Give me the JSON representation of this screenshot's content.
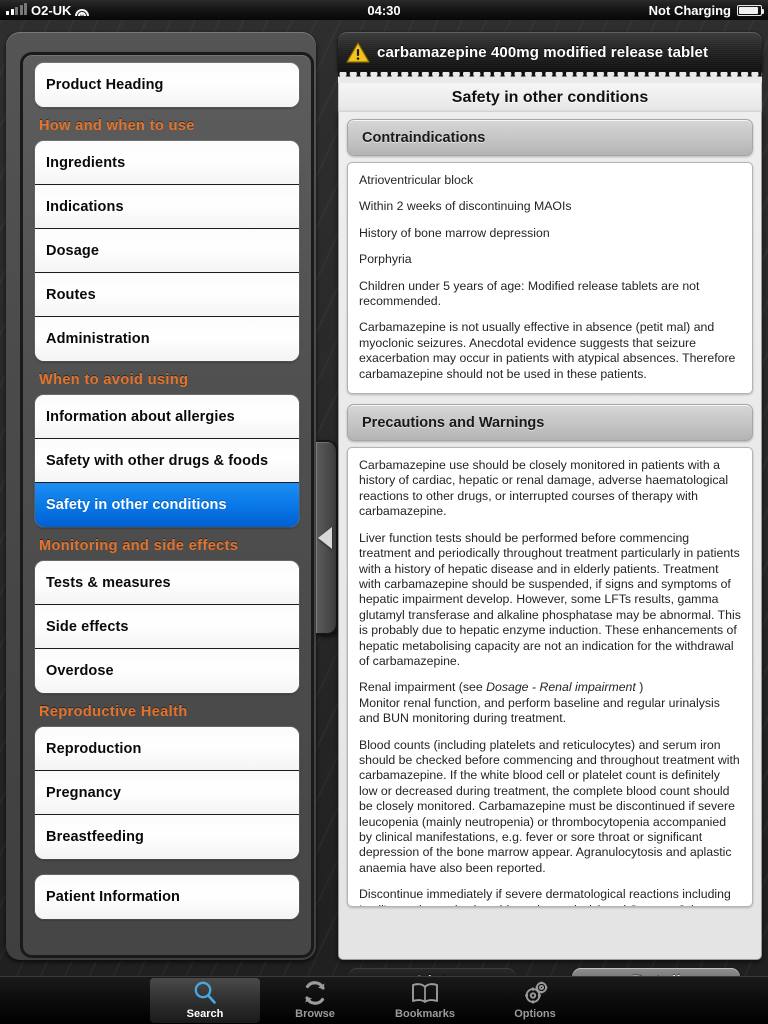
{
  "status_bar": {
    "carrier": "O2-UK",
    "signal_icon": "signal-bars-icon",
    "wifi_icon": "wifi-icon",
    "time": "04:30",
    "battery_text": "Not Charging",
    "battery_icon": "battery-icon"
  },
  "sidebar": {
    "collapse_handle_icon": "chevron-left-icon",
    "groups": [
      {
        "header": null,
        "items": [
          {
            "label": "Product Heading",
            "selected": false
          }
        ]
      },
      {
        "header": "How and  when to use",
        "items": [
          {
            "label": "Ingredients",
            "selected": false
          },
          {
            "label": "Indications",
            "selected": false
          },
          {
            "label": "Dosage",
            "selected": false
          },
          {
            "label": "Routes",
            "selected": false
          },
          {
            "label": "Administration",
            "selected": false
          }
        ]
      },
      {
        "header": "When to avoid using",
        "items": [
          {
            "label": "Information about allergies",
            "selected": false
          },
          {
            "label": "Safety with other drugs & foods",
            "selected": false
          },
          {
            "label": "Safety in other conditions",
            "selected": true
          }
        ]
      },
      {
        "header": "Monitoring and side effects",
        "items": [
          {
            "label": "Tests & measures",
            "selected": false
          },
          {
            "label": "Side effects",
            "selected": false
          },
          {
            "label": "Overdose",
            "selected": false
          }
        ]
      },
      {
        "header": "Reproductive Health",
        "items": [
          {
            "label": "Reproduction",
            "selected": false
          },
          {
            "label": "Pregnancy",
            "selected": false
          },
          {
            "label": "Breastfeeding",
            "selected": false
          }
        ]
      },
      {
        "header": null,
        "items": [
          {
            "label": "Patient Information",
            "selected": false
          }
        ]
      }
    ]
  },
  "detail": {
    "warning_icon": "warning-triangle-icon",
    "drug_title": "carbamazepine  400mg modified release tablet",
    "page_title": "Safety in other conditions",
    "sections": [
      {
        "heading": "Contraindications",
        "paragraphs": [
          "Atrioventricular block",
          "Within 2 weeks of discontinuing MAOIs",
          "History of bone marrow depression",
          "Porphyria",
          "Children under 5 years of age: Modified release tablets are not recommended.",
          "Carbamazepine is not usually effective in absence (petit mal) and myoclonic seizures.  Anecdotal evidence suggests that seizure exacerbation may occur in patients with atypical absences.  Therefore carbamazepine should not be used in these patients."
        ]
      },
      {
        "heading": "Precautions and Warnings",
        "paragraphs": [
          "Carbamazepine use should be closely monitored in patients with a history of cardiac, hepatic or renal damage, adverse haematological reactions to other drugs, or interrupted courses of therapy with carbamazepine.",
          "Liver function tests should be performed before commencing treatment and periodically throughout treatment particularly in patients with a history of hepatic disease and in elderly patients. Treatment with carbamazepine should be suspended, if signs and symptoms of hepatic impairment develop. However, some LFTs results, gamma glutamyl transferase and alkaline phosphatase may be abnormal. This is probably due to hepatic enzyme induction.  These enhancements of hepatic metabolising capacity are not an indication for the withdrawal of carbamazepine.",
          "Renal impairment (see Dosage - Renal impairment )",
          "Monitor renal function, and perform baseline and regular urinalysis and BUN monitoring during treatment.",
          "Blood counts (including platelets and reticulocytes) and serum iron should be checked before commencing and throughout treatment with carbamazepine.  If the white blood cell or platelet count is definitely low or decreased during treatment, the complete blood count should be closely monitored. Carbamazepine must be discontinued if severe leucopenia (mainly neutropenia) or thrombocytopenia accompanied by clinical manifestations, e.g. fever or sore throat or significant depression of the bone marrow appear.  Agranulocytosis and aplastic anaemia have also been reported.",
          "Discontinue immediately if severe dermatological reactions including Lyell's syndrome (toxic epidermal necrolysis) and Stevens-Johnson syndrome occur, as these conditions may be life threatening or fatal."
        ]
      }
    ]
  },
  "segmented": {
    "list_label": "List",
    "detail_label": "Detail",
    "active": "Detail"
  },
  "tabbar": {
    "tabs": [
      {
        "label": "Search",
        "icon": "search-icon",
        "active": true
      },
      {
        "label": "Browse",
        "icon": "refresh-icon",
        "active": false
      },
      {
        "label": "Bookmarks",
        "icon": "book-icon",
        "active": false
      },
      {
        "label": "Options",
        "icon": "gears-icon",
        "active": false
      }
    ]
  },
  "colors": {
    "accent_orange": "#e4742c",
    "selection_blue": "#0a7ae8",
    "warning_yellow": "#f2c31c",
    "active_tab_blue": "#4aa8e0"
  }
}
